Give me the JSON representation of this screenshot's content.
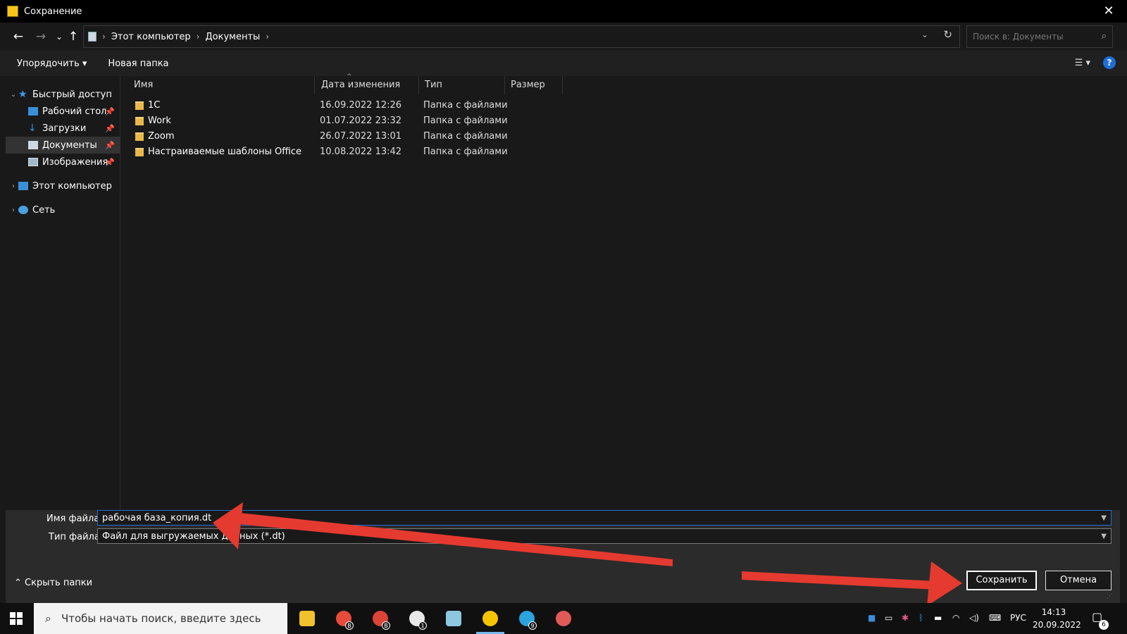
{
  "window": {
    "title": "Сохранение",
    "close_glyph": "✕"
  },
  "nav": {
    "back_glyph": "←",
    "forward_glyph": "→",
    "recent_glyph": "⌄",
    "up_glyph": "↑",
    "breadcrumb": [
      "Этот компьютер",
      "Документы"
    ],
    "search_placeholder": "Поиск в: Документы",
    "refresh_glyph": "↻"
  },
  "toolbar": {
    "organize": "Упорядочить ▾",
    "new_folder": "Новая папка",
    "view_glyph": "☰ ▾",
    "help_glyph": "?"
  },
  "tree": {
    "quick_access": "Быстрый доступ",
    "items": [
      {
        "label": "Рабочий стол",
        "icon": "desktop-icon"
      },
      {
        "label": "Загрузки",
        "icon": "downloads-icon"
      },
      {
        "label": "Документы",
        "icon": "documents-icon"
      },
      {
        "label": "Изображения",
        "icon": "pictures-icon"
      }
    ],
    "this_pc": "Этот компьютер",
    "network": "Сеть",
    "pin_glyph": "📌"
  },
  "columns": {
    "name": "Имя",
    "date": "Дата изменения",
    "type": "Тип",
    "size": "Размер"
  },
  "files": [
    {
      "name": "1С",
      "date": "16.09.2022 12:26",
      "type": "Папка с файлами"
    },
    {
      "name": "Work",
      "date": "01.07.2022 23:32",
      "type": "Папка с файлами"
    },
    {
      "name": "Zoom",
      "date": "26.07.2022 13:01",
      "type": "Папка с файлами"
    },
    {
      "name": "Настраиваемые шаблоны Office",
      "date": "10.08.2022 13:42",
      "type": "Папка с файлами"
    }
  ],
  "bottom": {
    "filename_label": "Имя файла:",
    "filename_value": "рабочая база_копия.dt",
    "filetype_label": "Тип файла:",
    "filetype_value": "Файл для выгружаемых данных (*.dt)",
    "hide_folders": "Скрыть папки",
    "save": "Сохранить",
    "cancel": "Отмена"
  },
  "taskbar": {
    "search_placeholder": "Чтобы начать поиск, введите здесь",
    "apps": [
      {
        "name": "file-explorer",
        "color": "#f2c12e"
      },
      {
        "name": "chrome",
        "color": "#e64a3b",
        "badge": "В"
      },
      {
        "name": "chrome-profile",
        "color": "#db4437",
        "badge": "В"
      },
      {
        "name": "slack",
        "color": "#e8e8e8",
        "badge": "1"
      },
      {
        "name": "notes-app",
        "color": "#8ec7e0"
      },
      {
        "name": "1c-app",
        "color": "#f5c400",
        "active": true
      },
      {
        "name": "telegram",
        "color": "#2aa3df",
        "badge": "9"
      },
      {
        "name": "snip-app",
        "color": "#e05a5a"
      }
    ],
    "language": "РУС",
    "time": "14:13",
    "date": "20.09.2022",
    "notifications_count": "6"
  },
  "colors": {
    "accent": "#1e6fd9",
    "annotation": "#e53a2f",
    "folder": "#e8b84a"
  }
}
